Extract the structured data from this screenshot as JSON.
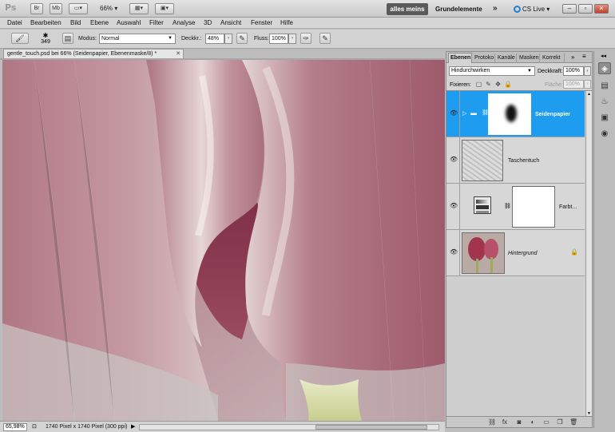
{
  "appbar": {
    "logo": "Ps",
    "zoom": "66%",
    "workspace_active": "alles meins",
    "workspace_label": "Grundelemente",
    "more": "»",
    "cslive": "CS Live",
    "bridge_label": "Br",
    "minibridge_label": "Mb"
  },
  "menu": [
    "Datei",
    "Bearbeiten",
    "Bild",
    "Ebene",
    "Auswahl",
    "Filter",
    "Analyse",
    "3D",
    "Ansicht",
    "Fenster",
    "Hilfe"
  ],
  "options": {
    "brush_size": "349",
    "mode_label": "Modus:",
    "mode_value": "Normal",
    "opacity_label": "Deckkr.:",
    "opacity_value": "48%",
    "flow_label": "Fluss:",
    "flow_value": "100%"
  },
  "document": {
    "tab_title": "gentle_touch.psd bei 66% (Seidenpapier, Ebenenmaske/8) *",
    "zoom": "65,98%",
    "info": "1740 Pixel x 1740 Pixel (300 ppi)"
  },
  "panel": {
    "tabs": [
      "Ebenen",
      "Protoko",
      "Kanäle",
      "Masken",
      "Korrekt"
    ],
    "blend_mode": "Hindurchwirken",
    "opacity_label": "Deckkraft:",
    "opacity_value": "100%",
    "lock_label": "Fixieren:",
    "fill_label": "Fläche:",
    "fill_value": "100%",
    "layers": [
      {
        "name": "Seidenpapier"
      },
      {
        "name": "Taschentuch"
      },
      {
        "name": "Farbt..."
      },
      {
        "name": "Hintergrund"
      }
    ]
  }
}
